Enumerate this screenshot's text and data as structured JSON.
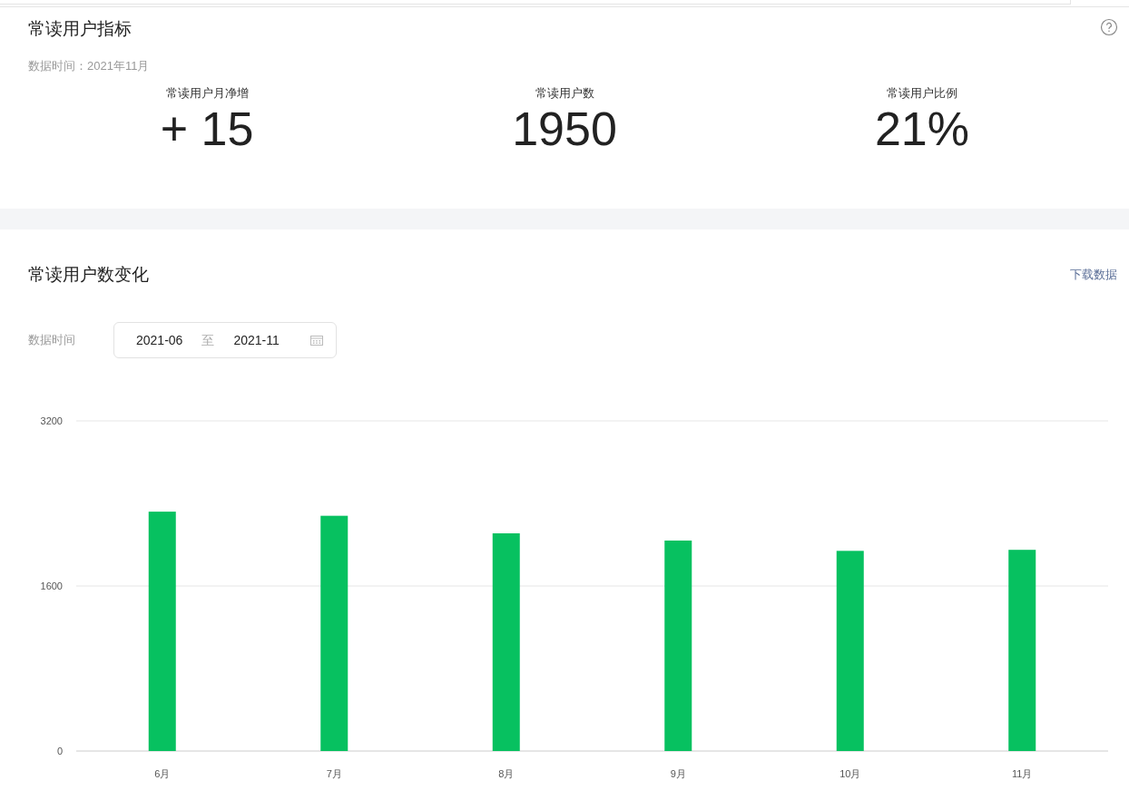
{
  "indicators": {
    "title": "常读用户指标",
    "data_time": "数据时间：2021年11月",
    "metrics": [
      {
        "label": "常读用户月净增",
        "value": "+ 15"
      },
      {
        "label": "常读用户数",
        "value": "1950"
      },
      {
        "label": "常读用户比例",
        "value": "21%"
      }
    ]
  },
  "trend": {
    "title": "常读用户数变化",
    "download": "下载数据",
    "date_label": "数据时间",
    "start": "2021-06",
    "separator": "至",
    "end": "2021-11",
    "chart_data": {
      "type": "bar",
      "categories": [
        "6月",
        "7月",
        "8月",
        "9月",
        "10月",
        "11月"
      ],
      "series": [
        {
          "color": "#07c160",
          "values": [
            2320,
            2280,
            2110,
            2040,
            1940,
            1950
          ]
        }
      ],
      "ylim": [
        0,
        3200
      ],
      "yticks": [
        0,
        1600,
        3200
      ]
    }
  }
}
